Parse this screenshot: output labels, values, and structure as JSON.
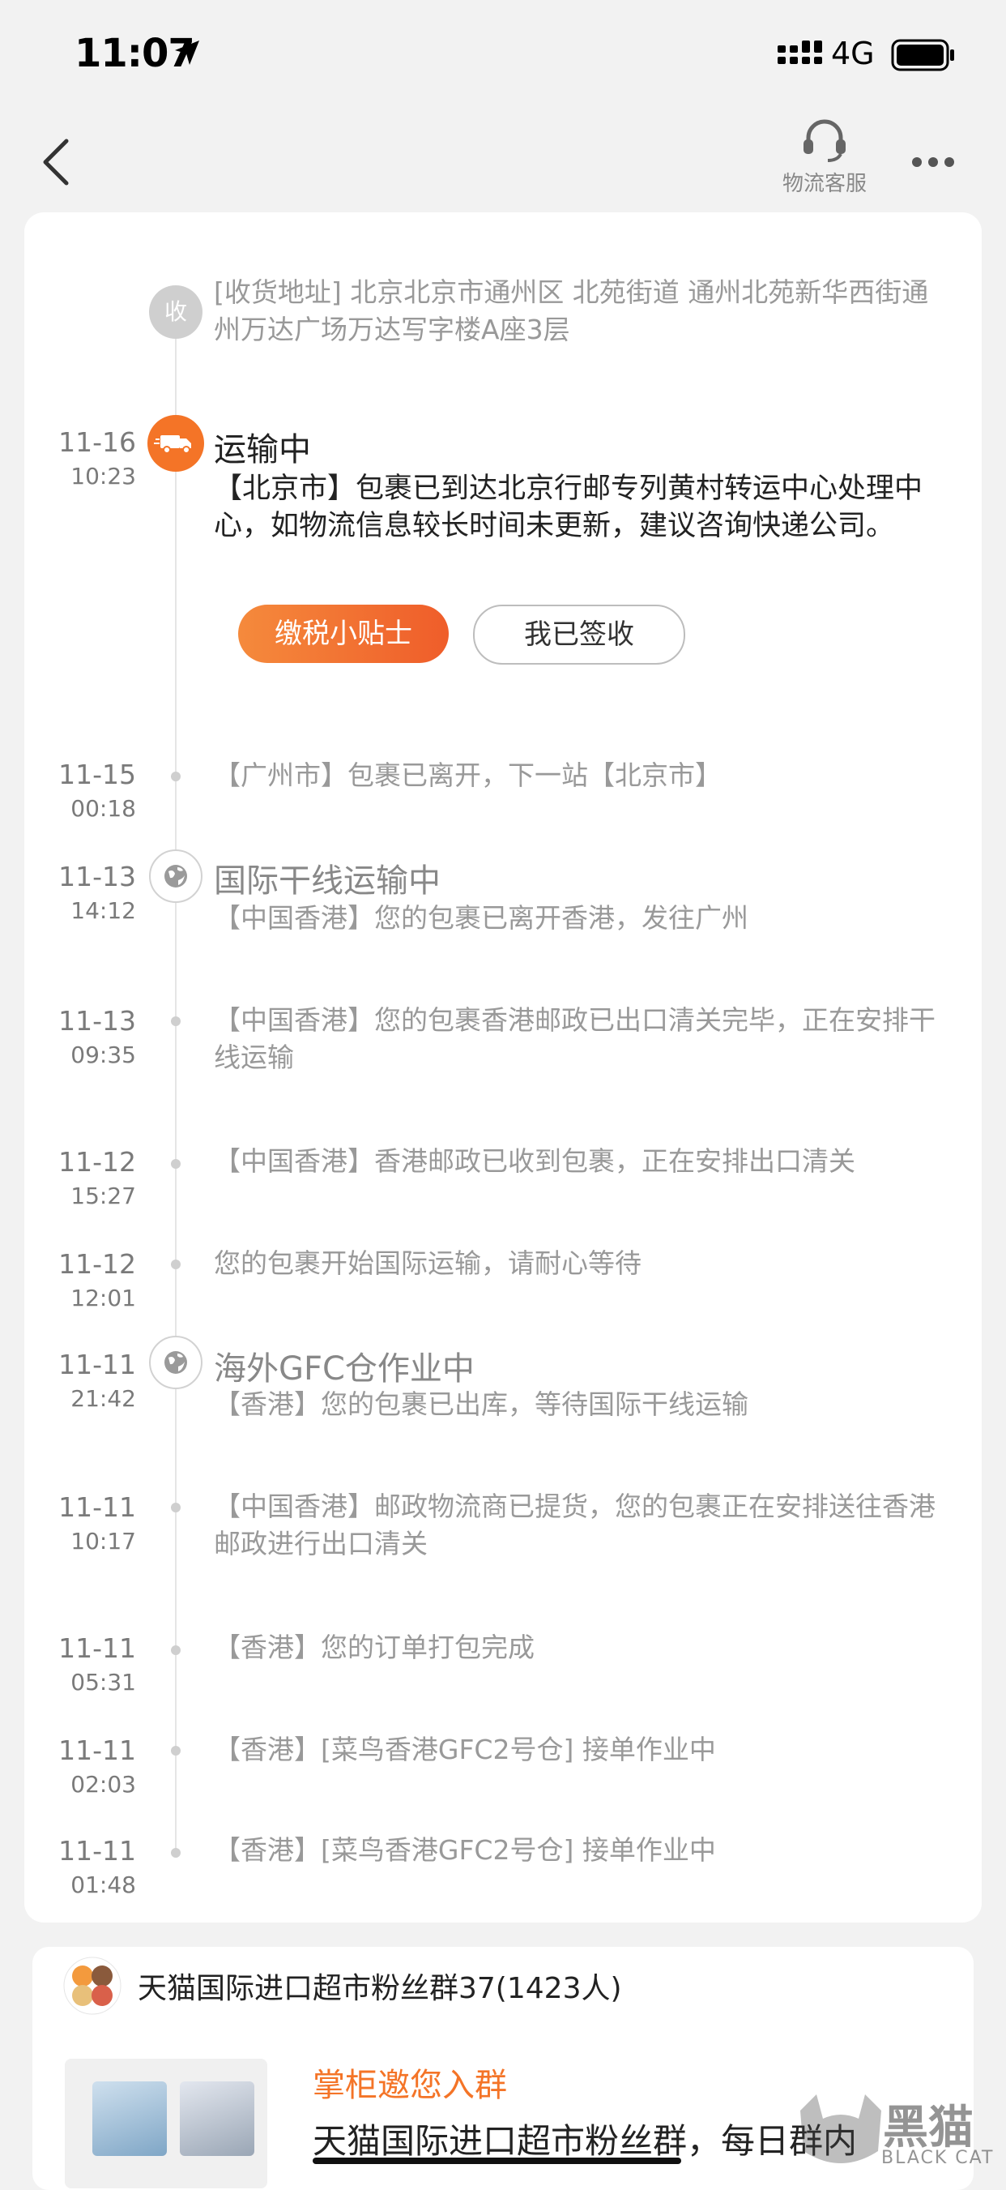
{
  "status_bar": {
    "time": "11:07",
    "network": "4G"
  },
  "nav": {
    "service_label": "物流客服"
  },
  "address": {
    "badge": "收",
    "text": "[收货地址] 北京北京市通州区  北苑街道   通州北苑新华西街通州万达广场万达写字楼A座3层"
  },
  "current": {
    "date": "11-16",
    "time": "10:23",
    "title": "运输中",
    "text": "【北京市】包裹已到达北京行邮专列黄村转运中心处理中心，如物流信息较长时间未更新，建议咨询快递公司。",
    "btn_tax": "缴税小贴士",
    "btn_signed": "我已签收"
  },
  "events": [
    {
      "date": "11-15",
      "time": "00:18",
      "text": "【广州市】包裹已离开，下一站【北京市】"
    },
    {
      "date": "11-13",
      "time": "14:12",
      "title": "国际干线运输中",
      "text": "【中国香港】您的包裹已离开香港，发往广州"
    },
    {
      "date": "11-13",
      "time": "09:35",
      "text": "【中国香港】您的包裹香港邮政已出口清关完毕，正在安排干线运输"
    },
    {
      "date": "11-12",
      "time": "15:27",
      "text": "【中国香港】香港邮政已收到包裹，正在安排出口清关"
    },
    {
      "date": "11-12",
      "time": "12:01",
      "text": "您的包裹开始国际运输，请耐心等待"
    },
    {
      "date": "11-11",
      "time": "21:42",
      "title": "海外GFC仓作业中",
      "text": "【香港】您的包裹已出库，等待国际干线运输"
    },
    {
      "date": "11-11",
      "time": "10:17",
      "text": "【中国香港】邮政物流商已提货，您的包裹正在安排送往香港邮政进行出口清关"
    },
    {
      "date": "11-11",
      "time": "05:31",
      "text": "【香港】您的订单打包完成"
    },
    {
      "date": "11-11",
      "time": "02:03",
      "text": "【香港】[菜鸟香港GFC2号仓] 接单作业中"
    },
    {
      "date": "11-11",
      "time": "01:48",
      "text": "【香港】[菜鸟香港GFC2号仓] 接单作业中"
    }
  ],
  "group": {
    "title": "天猫国际进口超市粉丝群37(1423人)",
    "invite_title": "掌柜邀您入群",
    "invite_desc": "天猫国际进口超市粉丝群，每日群内"
  },
  "watermark": {
    "text": "黑猫",
    "sub": "BLACK CAT"
  },
  "colors": {
    "accent": "#f47427",
    "muted": "#999999"
  }
}
